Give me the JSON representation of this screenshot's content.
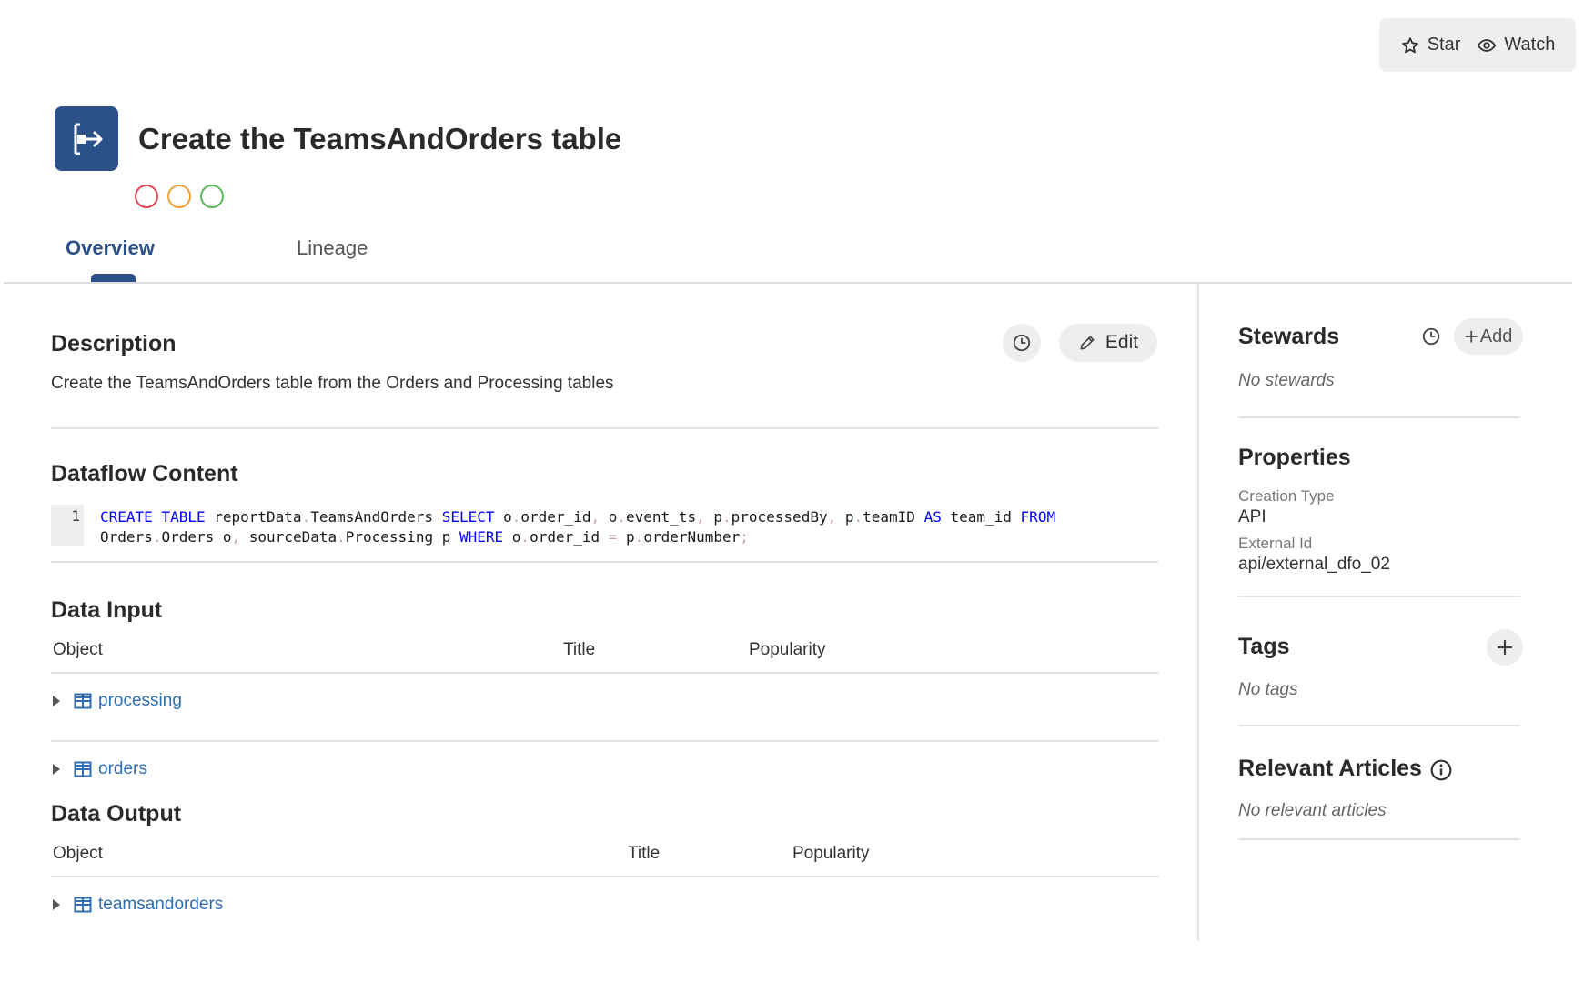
{
  "top_actions": {
    "star_label": "Star",
    "watch_label": "Watch"
  },
  "header": {
    "title": "Create the TeamsAndOrders table",
    "logo_icon": "dataflow-icon",
    "brand_color": "#2c5188"
  },
  "quality_dots": [
    {
      "name": "quality-dot-red",
      "color": "#e0475b"
    },
    {
      "name": "quality-dot-orange",
      "color": "#eba23a"
    },
    {
      "name": "quality-dot-green",
      "color": "#5cb85c"
    }
  ],
  "tabs": [
    {
      "label": "Overview",
      "active": true
    },
    {
      "label": "Lineage",
      "active": false
    }
  ],
  "description": {
    "title": "Description",
    "edit_label": "Edit",
    "text": "Create the TeamsAndOrders table from the Orders and Processing tables"
  },
  "dataflow": {
    "title": "Dataflow Content",
    "line_number": "1",
    "line1": [
      {
        "t": "CREATE TABLE",
        "k": "kw"
      },
      {
        "t": " reportData",
        "k": ""
      },
      {
        "t": ".",
        "k": "pn"
      },
      {
        "t": "TeamsAndOrders ",
        "k": ""
      },
      {
        "t": "SELECT",
        "k": "kw"
      },
      {
        "t": " o",
        "k": ""
      },
      {
        "t": ".",
        "k": "pn"
      },
      {
        "t": "order_id",
        "k": ""
      },
      {
        "t": ",",
        "k": "pn"
      },
      {
        "t": " o",
        "k": ""
      },
      {
        "t": ".",
        "k": "pn"
      },
      {
        "t": "event_ts",
        "k": ""
      },
      {
        "t": ",",
        "k": "pn"
      },
      {
        "t": " p",
        "k": ""
      },
      {
        "t": ".",
        "k": "pn"
      },
      {
        "t": "processedBy",
        "k": ""
      },
      {
        "t": ",",
        "k": "pn"
      },
      {
        "t": " p",
        "k": ""
      },
      {
        "t": ".",
        "k": "pn"
      },
      {
        "t": "teamID ",
        "k": ""
      },
      {
        "t": "AS",
        "k": "kw"
      },
      {
        "t": " team_id ",
        "k": ""
      },
      {
        "t": "FROM",
        "k": "kw"
      }
    ],
    "line2": [
      {
        "t": "Orders",
        "k": ""
      },
      {
        "t": ".",
        "k": "pn"
      },
      {
        "t": "Orders o",
        "k": ""
      },
      {
        "t": ",",
        "k": "pn"
      },
      {
        "t": " sourceData",
        "k": ""
      },
      {
        "t": ".",
        "k": "pn"
      },
      {
        "t": "Processing p ",
        "k": ""
      },
      {
        "t": "WHERE",
        "k": "kw"
      },
      {
        "t": " o",
        "k": ""
      },
      {
        "t": ".",
        "k": "pn"
      },
      {
        "t": "order_id ",
        "k": ""
      },
      {
        "t": "=",
        "k": "pn"
      },
      {
        "t": " p",
        "k": ""
      },
      {
        "t": ".",
        "k": "pn"
      },
      {
        "t": "orderNumber",
        "k": ""
      },
      {
        "t": ";",
        "k": "pn"
      }
    ]
  },
  "data_input": {
    "title": "Data Input",
    "columns": {
      "object": "Object",
      "title": "Title",
      "popularity": "Popularity"
    },
    "rows": [
      {
        "name": "processing"
      },
      {
        "name": "orders"
      }
    ]
  },
  "data_output": {
    "title": "Data Output",
    "columns": {
      "object": "Object",
      "title": "Title",
      "popularity": "Popularity"
    },
    "rows": [
      {
        "name": "teamsandorders"
      }
    ]
  },
  "sidebar": {
    "stewards": {
      "title": "Stewards",
      "add_label": "Add",
      "empty": "No stewards"
    },
    "properties": {
      "title": "Properties",
      "items": [
        {
          "label": "Creation Type",
          "value": "API"
        },
        {
          "label": "External Id",
          "value": "api/external_dfo_02"
        }
      ]
    },
    "tags": {
      "title": "Tags",
      "empty": "No tags"
    },
    "articles": {
      "title": "Relevant Articles",
      "empty": "No relevant articles"
    }
  }
}
